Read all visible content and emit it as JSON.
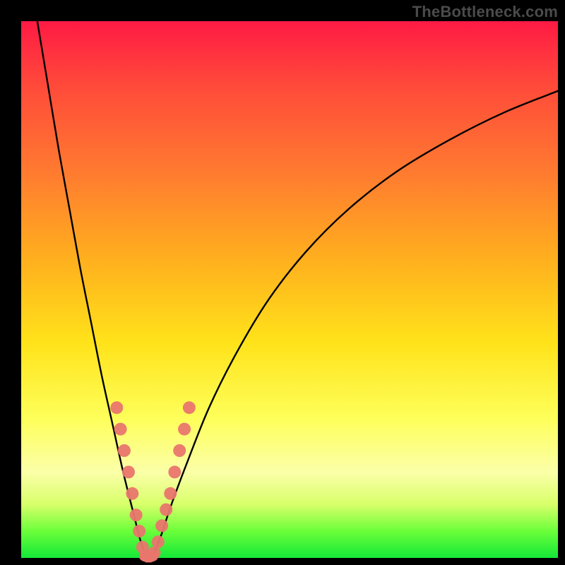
{
  "watermark": "TheBottleneck.com",
  "chart_data": {
    "type": "line",
    "title": "",
    "xlabel": "",
    "ylabel": "",
    "xlim": [
      0,
      100
    ],
    "ylim": [
      0,
      100
    ],
    "grid": false,
    "legend": false,
    "series": [
      {
        "name": "left-curve",
        "x": [
          3,
          5,
          7,
          9,
          11,
          13,
          15,
          17,
          19,
          21,
          22,
          23,
          23.7
        ],
        "y": [
          100,
          88,
          76,
          65,
          54,
          44,
          34,
          25,
          16,
          8,
          4,
          1,
          0
        ],
        "color": "#000000"
      },
      {
        "name": "right-curve",
        "x": [
          24.4,
          26,
          28,
          31,
          35,
          40,
          46,
          53,
          61,
          70,
          80,
          90,
          100
        ],
        "y": [
          0,
          4,
          10,
          18,
          28,
          38,
          48,
          57,
          65,
          72,
          78,
          83,
          87
        ],
        "color": "#000000"
      }
    ],
    "markers": [
      {
        "name": "left-cluster",
        "x": [
          17.8,
          18.5,
          19.2,
          20.0,
          20.7,
          21.4,
          22.0,
          22.6,
          23.2
        ],
        "y": [
          28,
          24,
          20,
          16,
          12,
          8,
          5,
          2,
          0.5
        ],
        "color": "#e9766d",
        "radius": 9
      },
      {
        "name": "right-cluster",
        "x": [
          24.8,
          25.5,
          26.2,
          27.0,
          27.8,
          28.6,
          29.5,
          30.4,
          31.3
        ],
        "y": [
          1,
          3,
          6,
          9,
          12,
          16,
          20,
          24,
          28
        ],
        "color": "#e9766d",
        "radius": 9
      },
      {
        "name": "bottom-fill",
        "x": [
          23.0,
          23.5,
          24.0,
          24.5
        ],
        "y": [
          0.4,
          0.2,
          0.2,
          0.4
        ],
        "color": "#e9766d",
        "radius": 8
      }
    ]
  }
}
